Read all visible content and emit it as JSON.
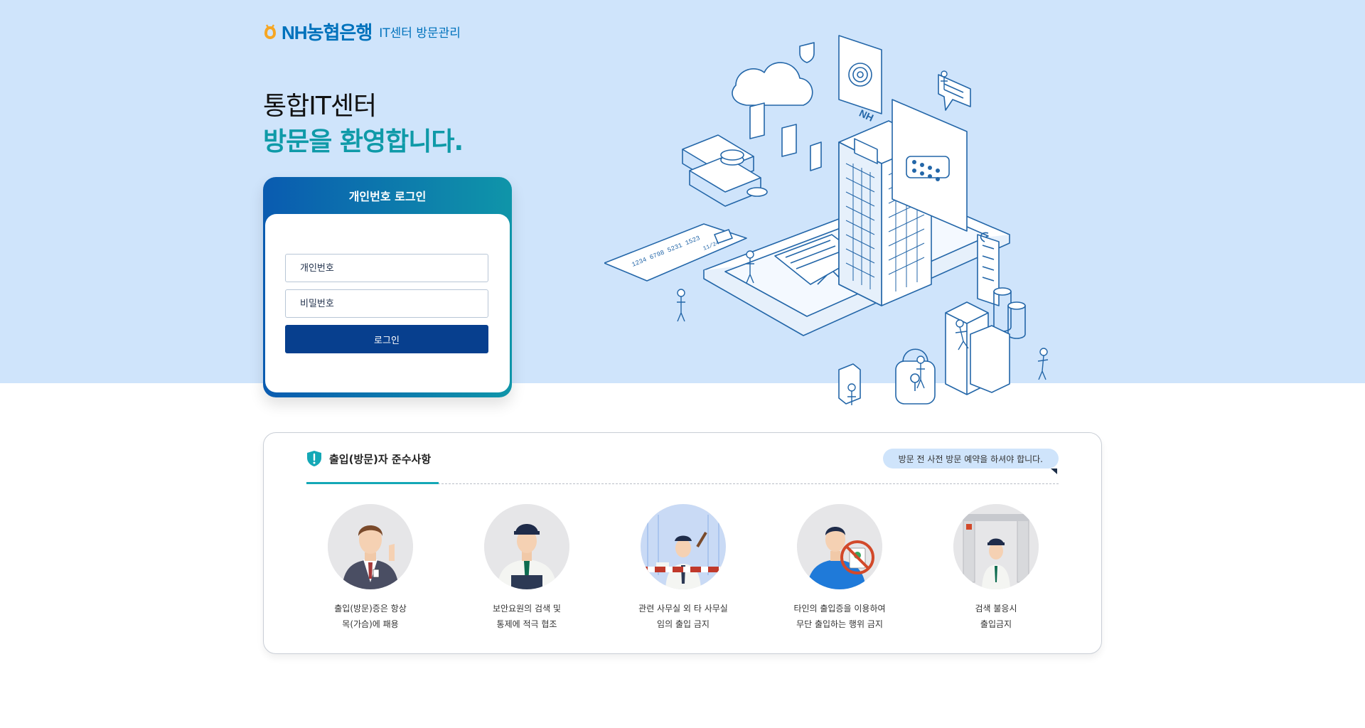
{
  "header": {
    "brand": "NH농협은행",
    "subtitle": "IT센터 방문관리"
  },
  "hero": {
    "title_line1": "통합IT센터",
    "title_line2": "방문을 환영합니다."
  },
  "login": {
    "title": "개인번호 로그인",
    "id_placeholder": "개인번호",
    "pw_placeholder": "비밀번호",
    "button_label": "로그인"
  },
  "illustration": {
    "card_number": "1234 6798 5231 1523",
    "card_expiry": "11/24",
    "building_sign": "NH"
  },
  "notice": {
    "title": "출입(방문)자 준수사항",
    "bubble": "방문 전 사전 방문 예약을 하셔야 합니다.",
    "rules": [
      {
        "line1": "출입(방문)증은 항상",
        "line2": "목(가슴)에 패용"
      },
      {
        "line1": "보안요원의 검색 및",
        "line2": "통제에 적극 협조"
      },
      {
        "line1": "관련 사무실 외 타 사무실",
        "line2": "임의 출입 금지"
      },
      {
        "line1": "타인의 출입증을 이용하여",
        "line2": "무단 출입하는 행위 금지"
      },
      {
        "line1": "검색 불응시",
        "line2": "출입금지"
      }
    ]
  },
  "colors": {
    "hero_bg": "#cfe4fb",
    "brand_blue": "#0072bc",
    "teal_accent": "#0f9aa8",
    "button_navy": "#073f8e"
  }
}
